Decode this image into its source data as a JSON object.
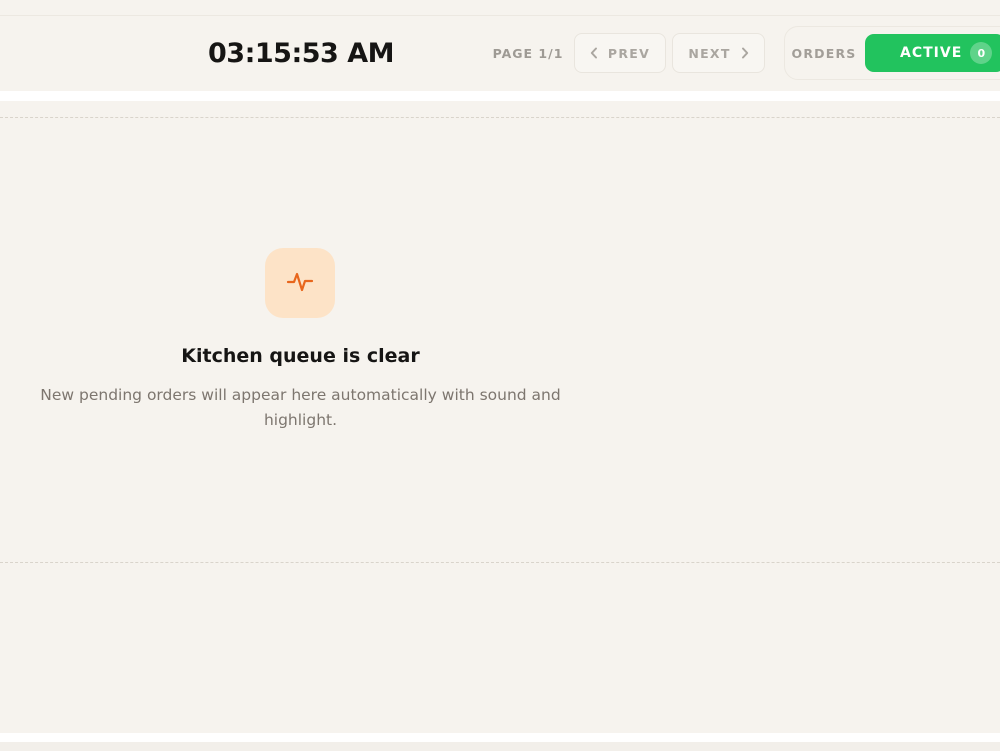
{
  "header": {
    "clock": "03:15:53 AM",
    "page_indicator": "PAGE 1/1",
    "prev_label": "PREV",
    "next_label": "NEXT",
    "prev_icon": "chevron-left-icon",
    "next_icon": "chevron-right-icon",
    "orders_label": "ORDERS",
    "active_label": "ACTIVE",
    "active_count": "0"
  },
  "empty_state": {
    "icon": "activity-icon",
    "title": "Kitchen queue is clear",
    "subtitle": "New pending orders will appear here automatically with sound and highlight."
  },
  "colors": {
    "background": "#f6f3ee",
    "accent_green": "#22c35e",
    "icon_tile": "#fde3c7",
    "icon_stroke": "#e8661c"
  }
}
